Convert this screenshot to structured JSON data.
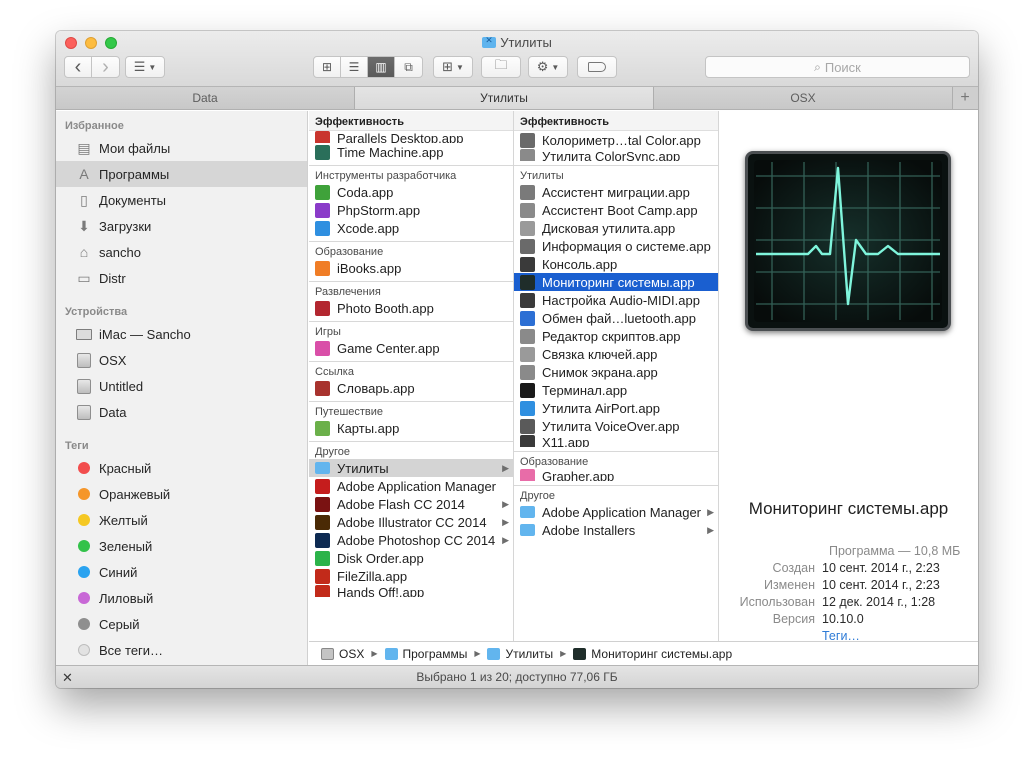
{
  "window": {
    "title": "Утилиты"
  },
  "toolbar": {
    "back": "‹",
    "forward": "›",
    "view_modes": [
      "icons",
      "list",
      "columns",
      "coverflow"
    ],
    "active_view": "columns",
    "search_placeholder": "Поиск"
  },
  "tabs": [
    {
      "label": "Data",
      "active": false
    },
    {
      "label": "Утилиты",
      "active": true
    },
    {
      "label": "OSX",
      "active": false
    }
  ],
  "sidebar": {
    "favorites_header": "Избранное",
    "favorites": [
      {
        "label": "Мои файлы",
        "icon": "all-files-icon"
      },
      {
        "label": "Программы",
        "icon": "applications-icon",
        "selected": true
      },
      {
        "label": "Документы",
        "icon": "documents-icon"
      },
      {
        "label": "Загрузки",
        "icon": "downloads-icon"
      },
      {
        "label": "sancho",
        "icon": "home-icon"
      },
      {
        "label": "Distr",
        "icon": "folder-icon"
      }
    ],
    "devices_header": "Устройства",
    "devices": [
      {
        "label": "iMac — Sancho",
        "icon": "imac-icon"
      },
      {
        "label": "OSX",
        "icon": "disk-icon"
      },
      {
        "label": "Untitled",
        "icon": "disk-icon"
      },
      {
        "label": "Data",
        "icon": "disk-icon"
      }
    ],
    "tags_header": "Теги",
    "tags": [
      {
        "label": "Красный",
        "color": "#f24d4d"
      },
      {
        "label": "Оранжевый",
        "color": "#f5962a"
      },
      {
        "label": "Желтый",
        "color": "#f5c823"
      },
      {
        "label": "Зеленый",
        "color": "#33c24a"
      },
      {
        "label": "Синий",
        "color": "#2aa3f0"
      },
      {
        "label": "Лиловый",
        "color": "#c868d6"
      },
      {
        "label": "Серый",
        "color": "#8f8f8f"
      },
      {
        "label": "Все теги…",
        "color": "#e2e2e2"
      }
    ]
  },
  "column1": {
    "header": "Эффективность",
    "groups": [
      {
        "items": [
          {
            "label": "Parallels Desktop.app",
            "color": "#c9352e",
            "clipped": true
          },
          {
            "label": "Time Machine.app",
            "color": "#2a6f5a"
          }
        ]
      },
      {
        "header": "Инструменты разработчика",
        "items": [
          {
            "label": "Coda.app",
            "color": "#3fa23a"
          },
          {
            "label": "PhpStorm.app",
            "color": "#8b3bc9"
          },
          {
            "label": "Xcode.app",
            "color": "#2f8fe0"
          }
        ]
      },
      {
        "header": "Образование",
        "items": [
          {
            "label": "iBooks.app",
            "color": "#f07d26"
          }
        ]
      },
      {
        "header": "Развлечения",
        "items": [
          {
            "label": "Photo Booth.app",
            "color": "#b32730"
          }
        ]
      },
      {
        "header": "Игры",
        "items": [
          {
            "label": "Game Center.app",
            "color": "#d94fa8"
          }
        ]
      },
      {
        "header": "Ссылка",
        "items": [
          {
            "label": "Словарь.app",
            "color": "#a8332e"
          }
        ]
      },
      {
        "header": "Путешествие",
        "items": [
          {
            "label": "Карты.app",
            "color": "#6bb04a"
          }
        ]
      },
      {
        "header": "Другое",
        "items": [
          {
            "label": "Утилиты",
            "color": "#62b5ee",
            "folder": true,
            "selected": true
          },
          {
            "label": "Adobe Application Manager",
            "color": "#c51d1d"
          },
          {
            "label": "Adobe Flash CC 2014",
            "color": "#7a1212",
            "folder_arrow": true
          },
          {
            "label": "Adobe Illustrator CC 2014",
            "color": "#4a2a05",
            "folder_arrow": true
          },
          {
            "label": "Adobe Photoshop CC 2014",
            "color": "#0d2a52",
            "folder_arrow": true
          },
          {
            "label": "Disk Order.app",
            "color": "#2bb34a"
          },
          {
            "label": "FileZilla.app",
            "color": "#c22a1a"
          },
          {
            "label": "Hands Off!.app",
            "color": "#c22a1a",
            "clipped": true
          }
        ]
      }
    ]
  },
  "column2": {
    "header": "Эффективность",
    "groups": [
      {
        "items": [
          {
            "label": "Колориметр…tal Color.app",
            "color": "#6a6a6a"
          },
          {
            "label": "Утилита ColorSync.app",
            "color": "#8a8a8a",
            "clipped": true
          }
        ]
      },
      {
        "header": "Утилиты",
        "items": [
          {
            "label": "Ассистент миграции.app",
            "color": "#7a7a7a"
          },
          {
            "label": "Ассистент Boot Camp.app",
            "color": "#8a8a8a"
          },
          {
            "label": "Дисковая утилита.app",
            "color": "#9a9a9a"
          },
          {
            "label": "Информация о системе.app",
            "color": "#6a6a6a"
          },
          {
            "label": "Консоль.app",
            "color": "#3a3a3a"
          },
          {
            "label": "Мониторинг системы.app",
            "color": "#1f2d2a",
            "selected": true
          },
          {
            "label": "Настройка Audio-MIDI.app",
            "color": "#3a3a3a"
          },
          {
            "label": "Обмен фай…luetooth.app",
            "color": "#2c6fd4"
          },
          {
            "label": "Редактор скриптов.app",
            "color": "#8a8a8a"
          },
          {
            "label": "Связка ключей.app",
            "color": "#9a9a9a"
          },
          {
            "label": "Снимок экрана.app",
            "color": "#8a8a8a"
          },
          {
            "label": "Терминал.app",
            "color": "#1a1a1a"
          },
          {
            "label": "Утилита AirPort.app",
            "color": "#2f8fe0"
          },
          {
            "label": "Утилита VoiceOver.app",
            "color": "#5a5a5a"
          },
          {
            "label": "X11.app",
            "color": "#3a3a3a",
            "clipped": true
          }
        ]
      },
      {
        "header": "Образование",
        "items": [
          {
            "label": "Grapher.app",
            "color": "#e86ca8",
            "clipped": true
          }
        ]
      },
      {
        "header": "Другое",
        "items": [
          {
            "label": "Adobe Application Manager",
            "color": "#62b5ee",
            "folder": true,
            "folder_arrow": true
          },
          {
            "label": "Adobe Installers",
            "color": "#62b5ee",
            "folder": true,
            "folder_arrow": true
          }
        ]
      }
    ]
  },
  "preview": {
    "name": "Мониторинг системы.app",
    "kind": "Программа — 10,8 МБ",
    "meta": [
      {
        "key": "Создан",
        "value": "10 сент. 2014 г., 2:23"
      },
      {
        "key": "Изменен",
        "value": "10 сент. 2014 г., 2:23"
      },
      {
        "key": "Использован",
        "value": "12 дек. 2014 г., 1:28"
      },
      {
        "key": "Версия",
        "value": "10.10.0"
      }
    ],
    "tags_link": "Теги…"
  },
  "pathbar": [
    {
      "label": "OSX",
      "icon": "disk-icon"
    },
    {
      "label": "Программы",
      "icon": "applications-folder-icon"
    },
    {
      "label": "Утилиты",
      "icon": "utilities-folder-icon"
    },
    {
      "label": "Мониторинг системы.app",
      "icon": "activity-monitor-icon"
    }
  ],
  "status": "Выбрано 1 из 20; доступно 77,06 ГБ"
}
